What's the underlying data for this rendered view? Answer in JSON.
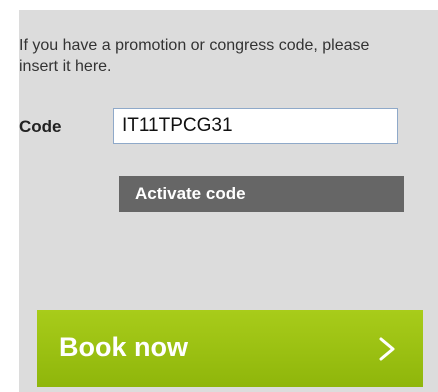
{
  "promo": {
    "intro_text": "If you have a promotion or congress code, please insert it here.",
    "code_label": "Code",
    "code_value": "IT11TPCG31",
    "activate_label": "Activate code"
  },
  "booking": {
    "book_label": "Book now",
    "icon": "chevron-right-icon"
  },
  "colors": {
    "panel_bg": "#dcdcdc",
    "activate_bg": "#666666",
    "book_bg": "#9bc112"
  }
}
